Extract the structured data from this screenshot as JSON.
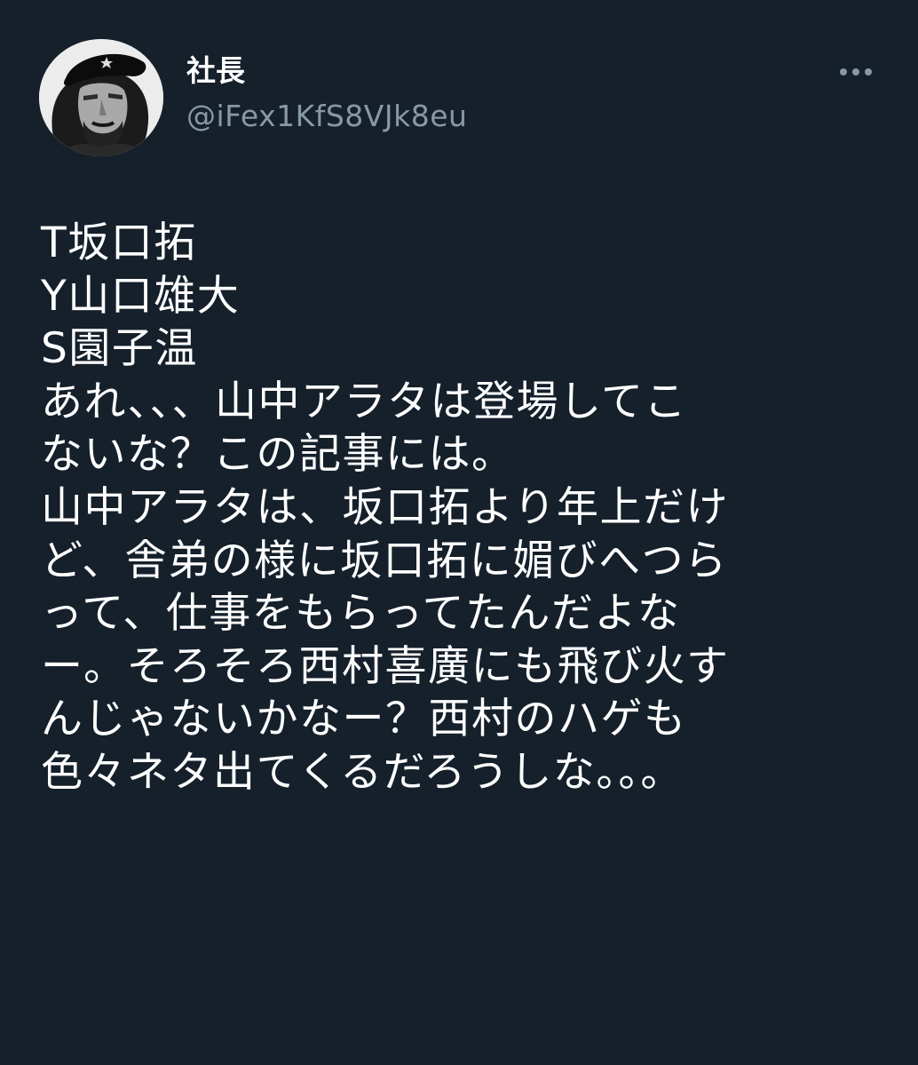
{
  "author": {
    "display_name": "社長",
    "handle": "@iFex1KfS8VJk8eu"
  },
  "more_icon": "more-horizontal-icon",
  "tweet": {
    "lines": [
      "T坂口拓",
      "Y山口雄大",
      "S園子温",
      "あれ、、、山中アラタは登場してこ",
      "ないな？この記事には。",
      "山中アラタは、坂口拓より年上だけ",
      "ど、舎弟の様に坂口拓に媚びへつら",
      "って、仕事をもらってたんだよな",
      "ー。そろそろ西村喜廣にも飛び火す",
      "んじゃないかなー？西村のハゲも",
      "色々ネタ出てくるだろうしな。。。"
    ]
  },
  "colors": {
    "background": "#15202b",
    "text": "#ffffff",
    "secondary_text": "#8899a6"
  }
}
